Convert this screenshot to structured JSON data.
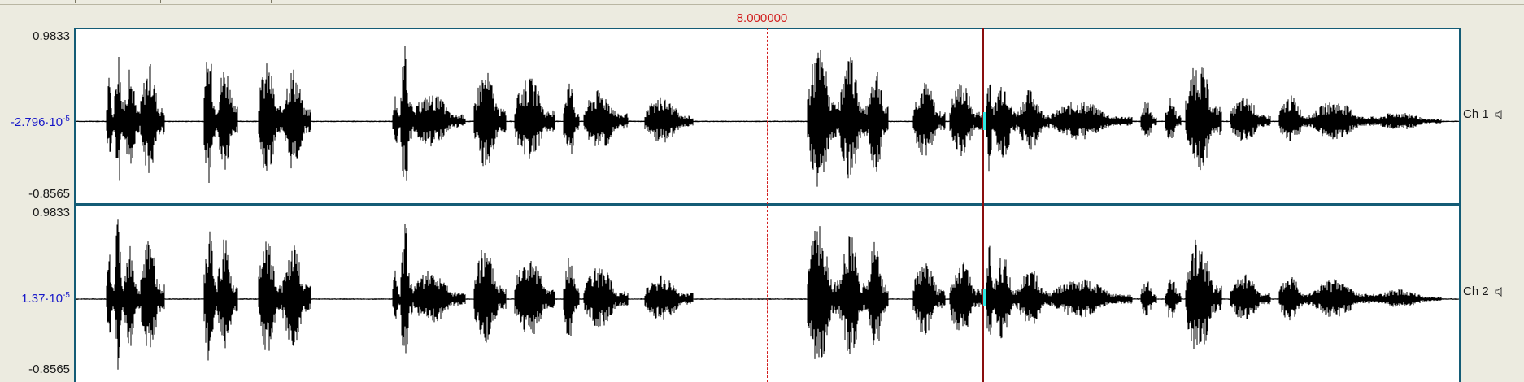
{
  "cursor": {
    "time_readout": "8.000000"
  },
  "channels": [
    {
      "id": "ch1",
      "label": "Ch 1",
      "max_label": "0.9833",
      "mid_label": "-2.796·10-5",
      "min_label": "-0.8565"
    },
    {
      "id": "ch2",
      "label": "Ch 2",
      "max_label": "0.9833",
      "mid_label": "1.37·10-5",
      "min_label": "-0.8565"
    }
  ],
  "colors": {
    "waveform": "#000000",
    "panel_border": "#145c76",
    "cursor_text": "#d21f1f",
    "play_cursor": "#8a0e0e",
    "selection_mark": "#2ee8e3",
    "axis_mid_label": "#1616c8"
  },
  "icons": {
    "channel_speaker": "speaker-icon"
  }
}
